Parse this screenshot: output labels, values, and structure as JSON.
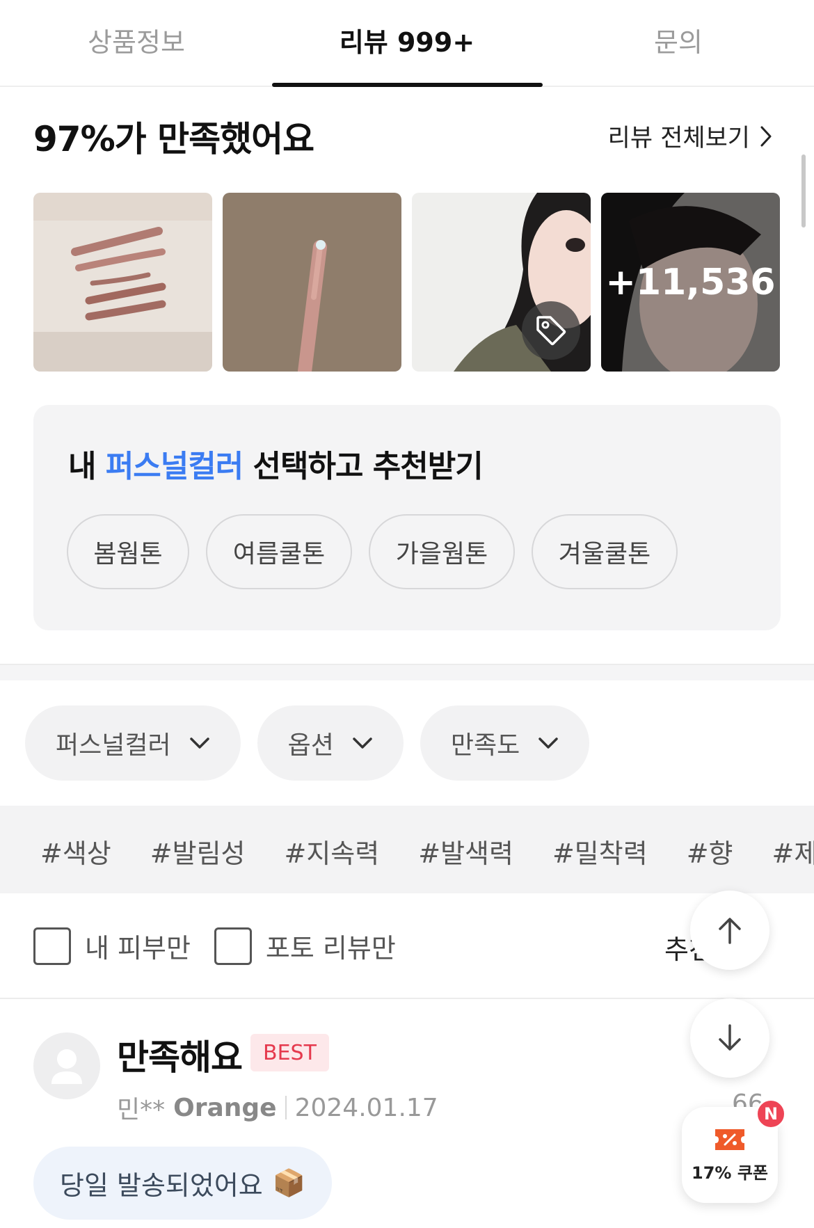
{
  "tabs": [
    {
      "label": "상품정보",
      "active": false
    },
    {
      "label": "리뷰 999+",
      "active": true
    },
    {
      "label": "문의",
      "active": false
    }
  ],
  "summary": {
    "title": "97%가 만족했어요",
    "view_all": "리뷰 전체보기"
  },
  "photos": {
    "more_count": "+11,536"
  },
  "personal_color": {
    "title_prefix": "내 ",
    "title_highlight": "퍼스널컬러",
    "title_suffix": " 선택하고 추천받기",
    "options": [
      "봄웜톤",
      "여름쿨톤",
      "가을웜톤",
      "겨울쿨톤"
    ]
  },
  "filters": [
    "퍼스널컬러",
    "옵션",
    "만족도"
  ],
  "hashtags": [
    "#색상",
    "#발림성",
    "#지속력",
    "#발색력",
    "#밀착력",
    "#향",
    "#제형"
  ],
  "checks": {
    "my_skin": "내 피부만",
    "photo_only": "포토 리뷰만"
  },
  "sort_label": "추천순",
  "review": {
    "title": "만족해요",
    "badge": "BEST",
    "author": "민**",
    "tone": "Orange",
    "date": "2024.01.17",
    "right_meta": "66",
    "chip_text": "당일 발송되었어요",
    "chip_emoji": "📦"
  },
  "coupon": {
    "label": "17% 쿠폰",
    "new_badge": "N"
  },
  "colors": {
    "highlight": "#3b7cf2",
    "best_red": "#e5394d",
    "badge_red": "#ee4455"
  }
}
